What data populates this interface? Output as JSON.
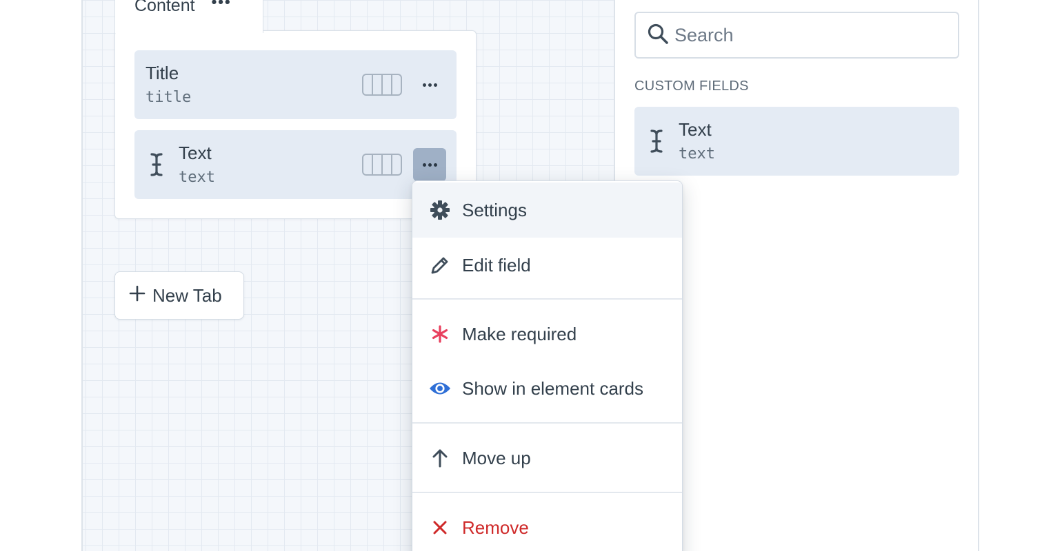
{
  "tab": {
    "title": "Content"
  },
  "fields": [
    {
      "name": "Title",
      "handle": "title"
    },
    {
      "name": "Text",
      "handle": "text"
    }
  ],
  "new_tab": {
    "label": "New Tab"
  },
  "library": {
    "search_placeholder": "Search",
    "section_label": "CUSTOM FIELDS",
    "items": [
      {
        "name": "Text",
        "handle": "text"
      }
    ]
  },
  "menu": {
    "items": [
      {
        "label": "Settings",
        "icon": "gear-icon"
      },
      {
        "label": "Edit field",
        "icon": "pencil-icon"
      },
      {
        "label": "Make required",
        "icon": "asterisk-icon"
      },
      {
        "label": "Show in element cards",
        "icon": "eye-icon"
      },
      {
        "label": "Move up",
        "icon": "arrow-up-icon"
      },
      {
        "label": "Remove",
        "icon": "x-icon"
      }
    ]
  },
  "colors": {
    "required": "#e8405e",
    "eye": "#2f6fd6",
    "danger": "#cf2a2a",
    "active_button": "#9fb0c6",
    "card_bg": "#e4ebf4"
  }
}
